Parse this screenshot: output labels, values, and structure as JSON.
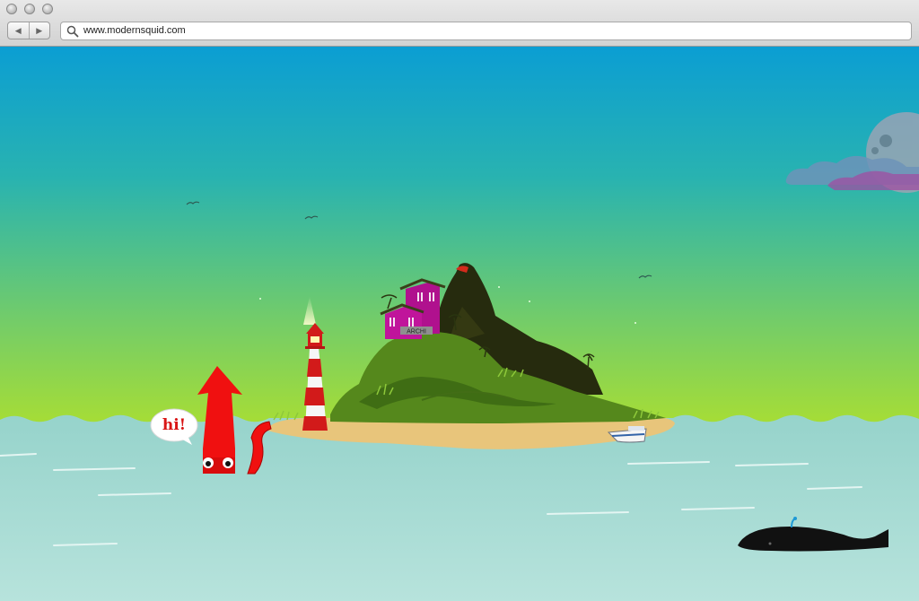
{
  "window": {
    "controls": [
      "close",
      "minimize",
      "zoom"
    ]
  },
  "toolbar": {
    "back_icon": "back-arrow-icon",
    "forward_icon": "forward-arrow-icon",
    "search_icon": "magnifier-icon",
    "url": "www.modernsquid.com"
  },
  "scene": {
    "speech_bubble": "hi!",
    "island_sign": "ARCHI",
    "colors": {
      "sky_top": "#0b9ed3",
      "sky_bottom": "#a6dd36",
      "sea": "#99d4cb",
      "squid": "#f01010",
      "house": "#b0118e",
      "sand": "#e8c57b",
      "whale": "#111111"
    }
  }
}
